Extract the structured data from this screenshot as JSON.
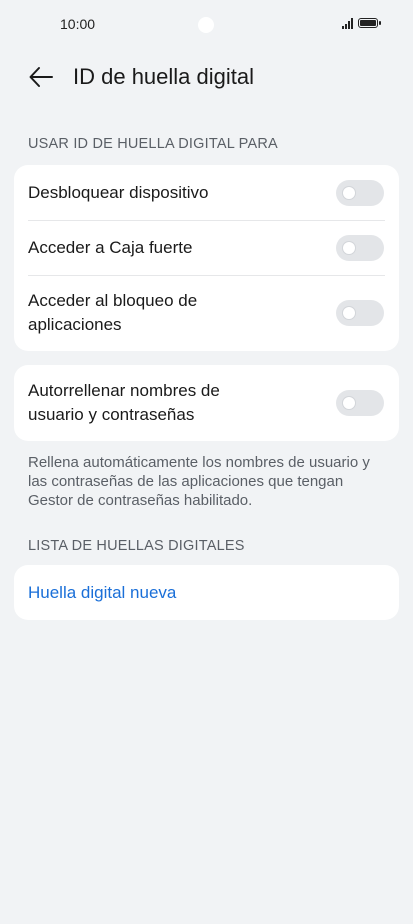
{
  "status": {
    "time": "10:00"
  },
  "header": {
    "title": "ID de huella digital"
  },
  "section_use": {
    "label": "USAR ID DE HUELLA DIGITAL PARA"
  },
  "use_items": [
    {
      "label": "Desbloquear dispositivo",
      "enabled": false
    },
    {
      "label": "Acceder a Caja fuerte",
      "enabled": false
    },
    {
      "label": "Acceder al bloqueo de aplicaciones",
      "enabled": false
    }
  ],
  "autofill": {
    "label": "Autorrellenar nombres de usuario y contraseñas",
    "enabled": false,
    "note": "Rellena automáticamente los nombres de usuario y las contraseñas de las aplicaciones que tengan Gestor de contraseñas habilitado."
  },
  "section_list": {
    "label": "LISTA DE HUELLAS DIGITALES"
  },
  "new_fingerprint": {
    "label": "Huella digital nueva"
  },
  "colors": {
    "accent": "#1a6fd8",
    "background": "#f1f3f5",
    "card": "#ffffff"
  }
}
